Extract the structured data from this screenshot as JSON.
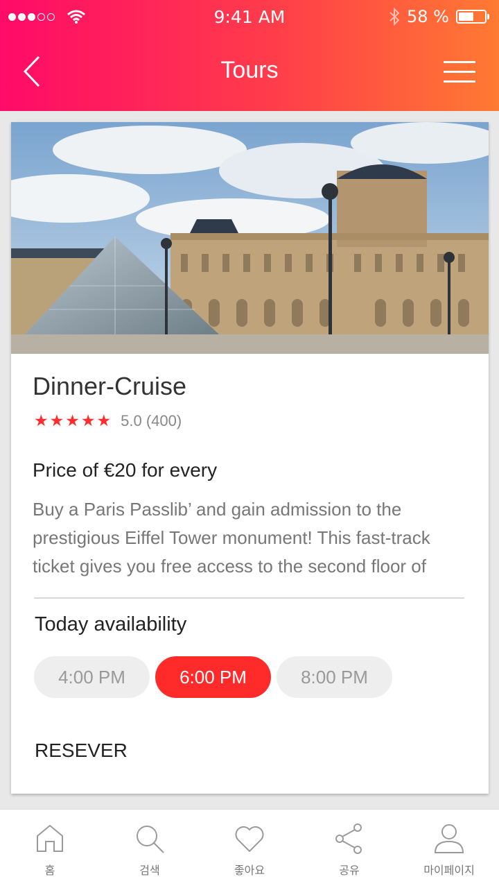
{
  "status_bar": {
    "time": "9:41 AM",
    "battery_text": "58 %",
    "battery_level": 0.58,
    "icons": [
      "signal-icon",
      "wifi-icon",
      "bluetooth-icon",
      "battery-icon"
    ]
  },
  "nav": {
    "title": "Tours",
    "icons": [
      "back-icon",
      "menu-icon"
    ]
  },
  "tour": {
    "title": "Dinner-Cruise",
    "rating": 5.0,
    "rating_text": "5.0 (400)",
    "stars": 5,
    "price": "Price of €20 for every",
    "description": "Buy a Paris Passlib’ and gain admission to the prestigious Eiffel Tower monument! This fast-track ticket gives you free access to the second floor of",
    "availability_title": "Today availability",
    "slots": [
      "4:00 PM",
      "6:00 PM",
      "8:00 PM"
    ],
    "selected_slot": "6:00 PM",
    "reserve_label": "RESEVER"
  },
  "tabbar": {
    "items": [
      {
        "label": "홈",
        "icon": "home-icon"
      },
      {
        "label": "검색",
        "icon": "search-icon"
      },
      {
        "label": "좋아요",
        "icon": "heart-icon"
      },
      {
        "label": "공유",
        "icon": "share-icon"
      },
      {
        "label": "마이페이지",
        "icon": "user-icon"
      }
    ]
  },
  "colors": {
    "header_gradient_start": "#ff0a68",
    "header_gradient_end": "#ff7a32",
    "accent": "#ff2a2a",
    "star": "#ff2d2d"
  }
}
